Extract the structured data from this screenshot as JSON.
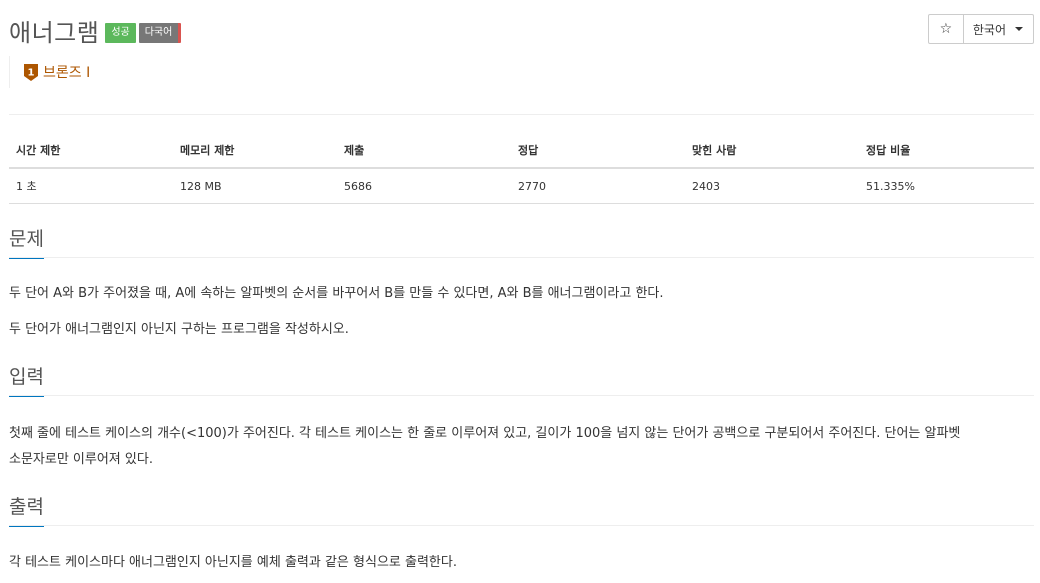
{
  "problem": {
    "title": "애너그램",
    "badges": {
      "success": "성공",
      "multilang": "다국어"
    }
  },
  "controls": {
    "star_glyph": "☆",
    "language": "한국어"
  },
  "tier": {
    "label": "브론즈 I",
    "icon_number": "1",
    "color": "#ad5600"
  },
  "stats": {
    "headers": [
      "시간 제한",
      "메모리 제한",
      "제출",
      "정답",
      "맞힌 사람",
      "정답 비율"
    ],
    "values": [
      "1 초",
      "128 MB",
      "5686",
      "2770",
      "2403",
      "51.335%"
    ]
  },
  "sections": {
    "description": {
      "heading": "문제",
      "paragraphs": [
        "두 단어 A와 B가 주어졌을 때, A에 속하는 알파벳의 순서를 바꾸어서 B를 만들 수 있다면, A와 B를 애너그램이라고 한다.",
        "두 단어가 애너그램인지 아닌지 구하는 프로그램을 작성하시오."
      ]
    },
    "input": {
      "heading": "입력",
      "lines": [
        "첫째 줄에 테스트 케이스의 개수(<100)가 주어진다. 각 테스트 케이스는 한 줄로 이루어져 있고, 길이가 100을 넘지 않는 단어가 공백으로 구분되어서 주어진다. 단어는 알파벳",
        "소문자로만 이루어져 있다."
      ]
    },
    "output": {
      "heading": "출력",
      "text": "각 테스트 케이스마다 애너그램인지 아닌지를 예체 출력과 같은 형식으로 출력한다."
    }
  },
  "colors": {
    "accent_underline": "#0076c0",
    "success": "#5cb85c",
    "multilang": "#777777"
  }
}
